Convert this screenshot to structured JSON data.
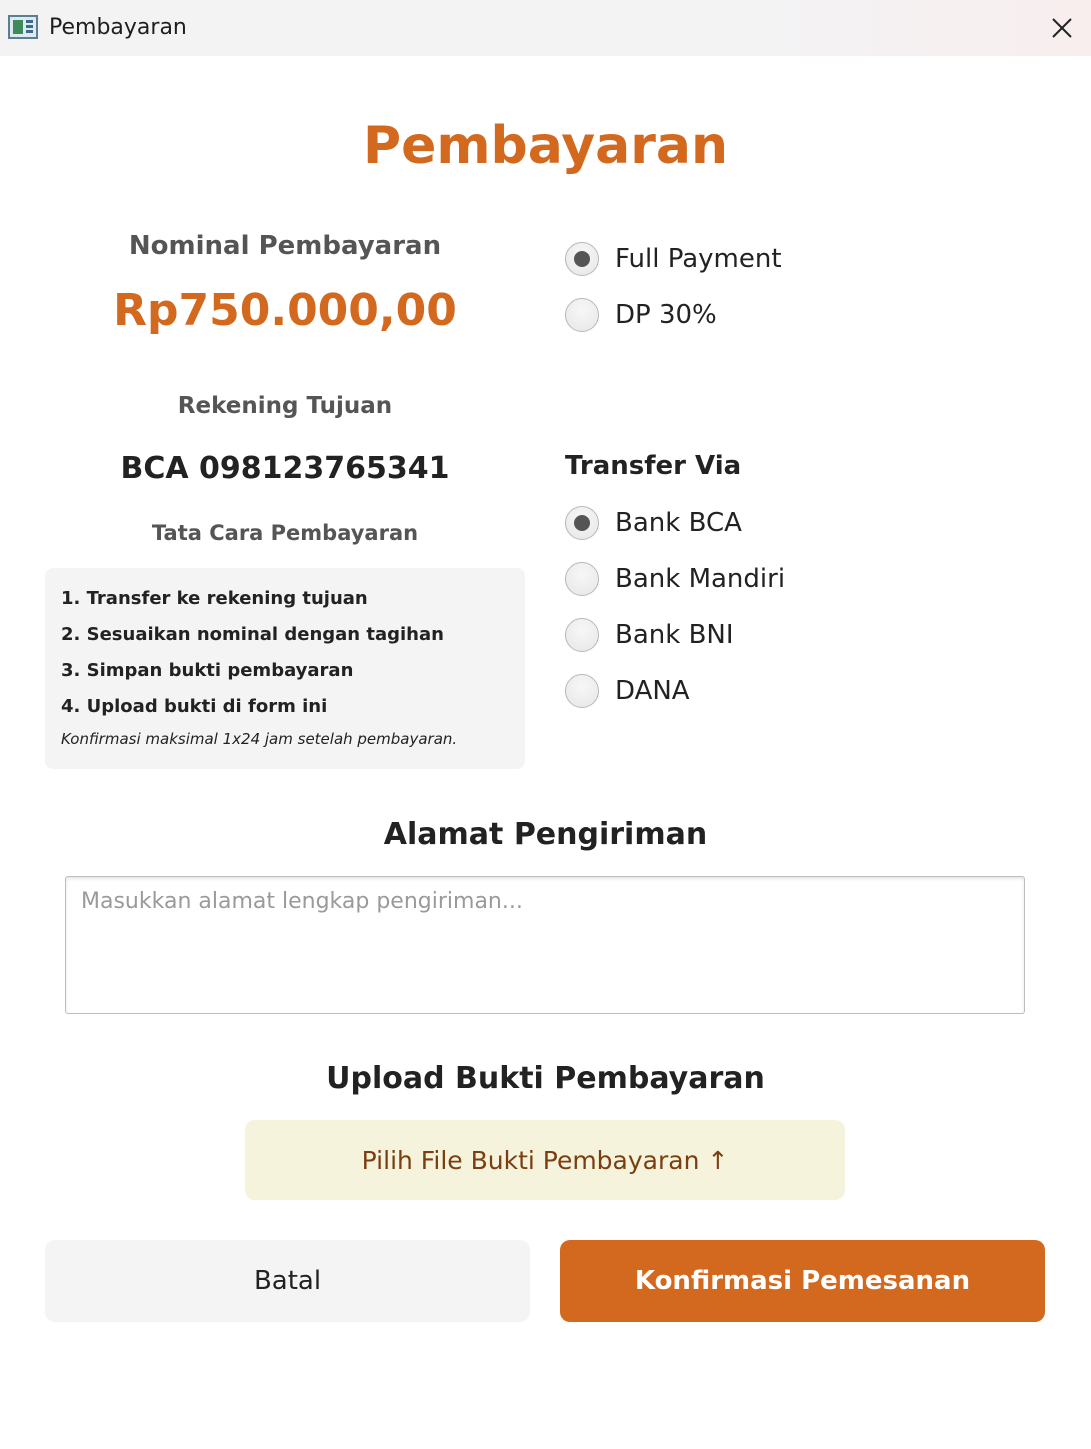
{
  "window": {
    "title": "Pembayaran"
  },
  "header": {
    "title": "Pembayaran"
  },
  "payment": {
    "nominal_label": "Nominal Pembayaran",
    "nominal_value": "Rp750.000,00",
    "options": [
      {
        "label": "Full Payment",
        "checked": true
      },
      {
        "label": "DP 30%",
        "checked": false
      }
    ]
  },
  "account": {
    "label": "Rekening Tujuan",
    "value": "BCA 098123765341"
  },
  "instructions": {
    "label": "Tata Cara Pembayaran",
    "steps": [
      "1. Transfer ke rekening tujuan",
      "2. Sesuaikan nominal dengan tagihan",
      "3. Simpan bukti pembayaran",
      "4. Upload bukti di form ini"
    ],
    "note": "Konfirmasi maksimal 1x24 jam setelah pembayaran."
  },
  "transfer": {
    "label": "Transfer Via",
    "options": [
      {
        "label": "Bank BCA",
        "checked": true
      },
      {
        "label": "Bank Mandiri",
        "checked": false
      },
      {
        "label": "Bank BNI",
        "checked": false
      },
      {
        "label": "DANA",
        "checked": false
      }
    ]
  },
  "address": {
    "title": "Alamat Pengiriman",
    "placeholder": "Masukkan alamat lengkap pengiriman...",
    "value": ""
  },
  "upload": {
    "title": "Upload Bukti Pembayaran",
    "button_label": "Pilih File Bukti Pembayaran ↑"
  },
  "actions": {
    "cancel_label": "Batal",
    "confirm_label": "Konfirmasi Pemesanan"
  },
  "colors": {
    "accent": "#d2691e",
    "upload_bg": "#f5f3dc",
    "panel_bg": "#f4f4f4"
  }
}
